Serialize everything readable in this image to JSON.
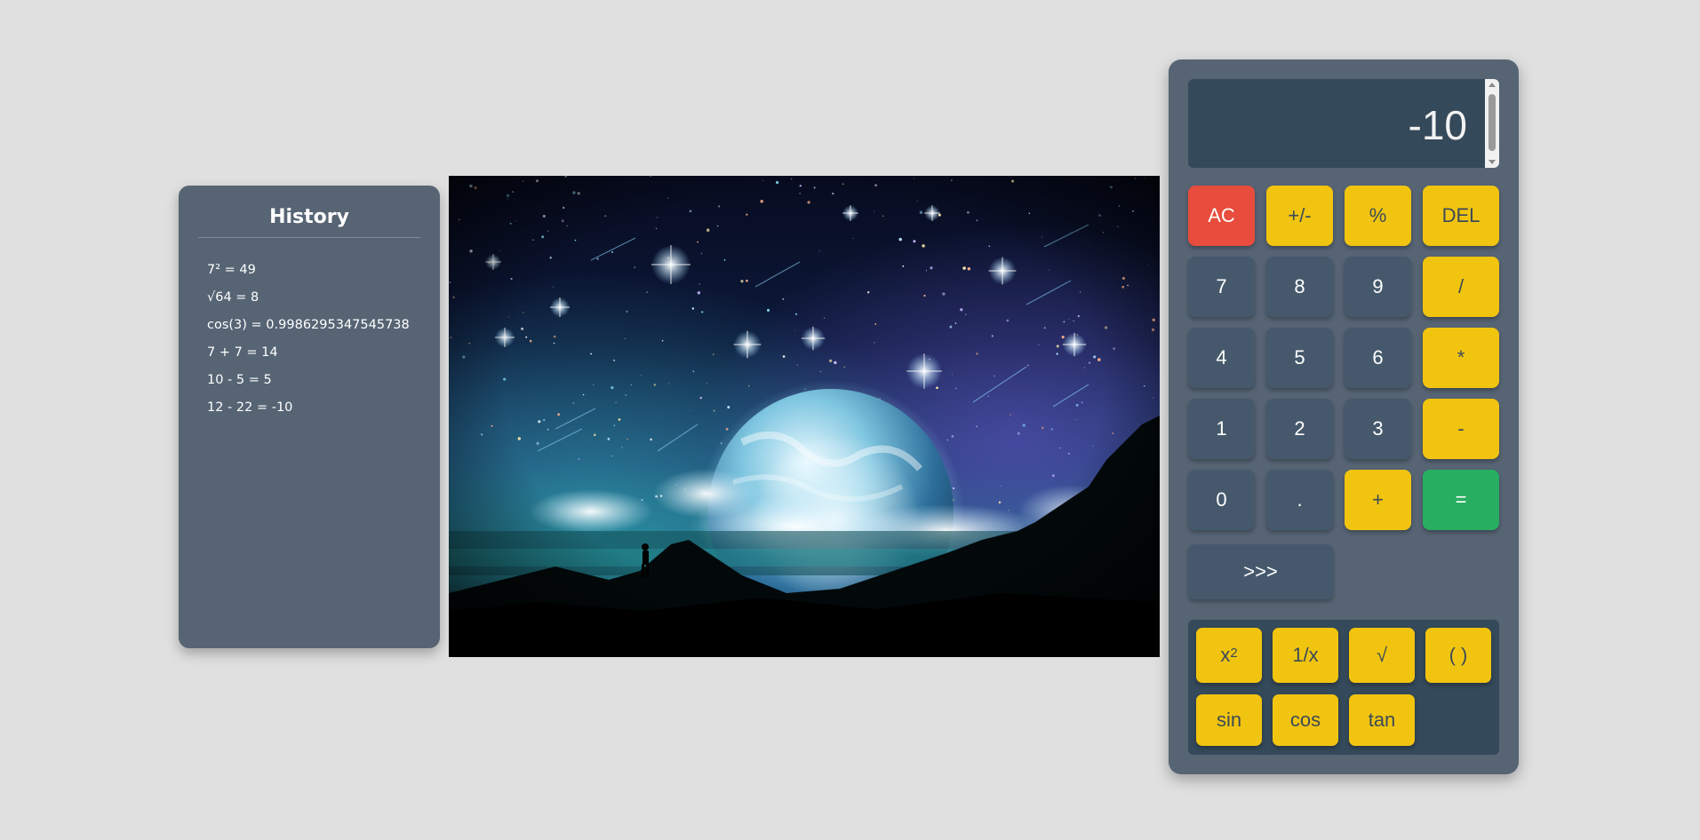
{
  "history": {
    "title": "History",
    "entries": [
      "7² = 49",
      "√64 = 8",
      "cos(3) = 0.9986295347545738",
      "7 + 7 = 14",
      "10 - 5 = 5",
      "12 - 22 = -10"
    ]
  },
  "image": {
    "scene": "night-sky-planet-illustration"
  },
  "calculator": {
    "display": "-10",
    "keys": {
      "ac": "AC",
      "negate": "+/-",
      "percent": "%",
      "delete": "DEL",
      "seven": "7",
      "eight": "8",
      "nine": "9",
      "divide": "/",
      "four": "4",
      "five": "5",
      "six": "6",
      "multiply": "*",
      "one": "1",
      "two": "2",
      "three": "3",
      "subtract": "-",
      "zero": "0",
      "decimal": ".",
      "add": "+",
      "equals": "=",
      "toggle_scientific": ">>>"
    },
    "scientific": {
      "square_base": "x",
      "square_exp": "2",
      "reciprocal": "1/x",
      "sqrt": "√",
      "parens": "( )",
      "sin": "sin",
      "cos": "cos",
      "tan": "tan"
    }
  },
  "colors": {
    "page_background": "#e0e0e0",
    "panel": "#566474",
    "display": "#34495a",
    "number_key": "#46596c",
    "operator_key": "#f1c40f",
    "clear_key": "#e74c3c",
    "equals_key": "#27ae60"
  }
}
